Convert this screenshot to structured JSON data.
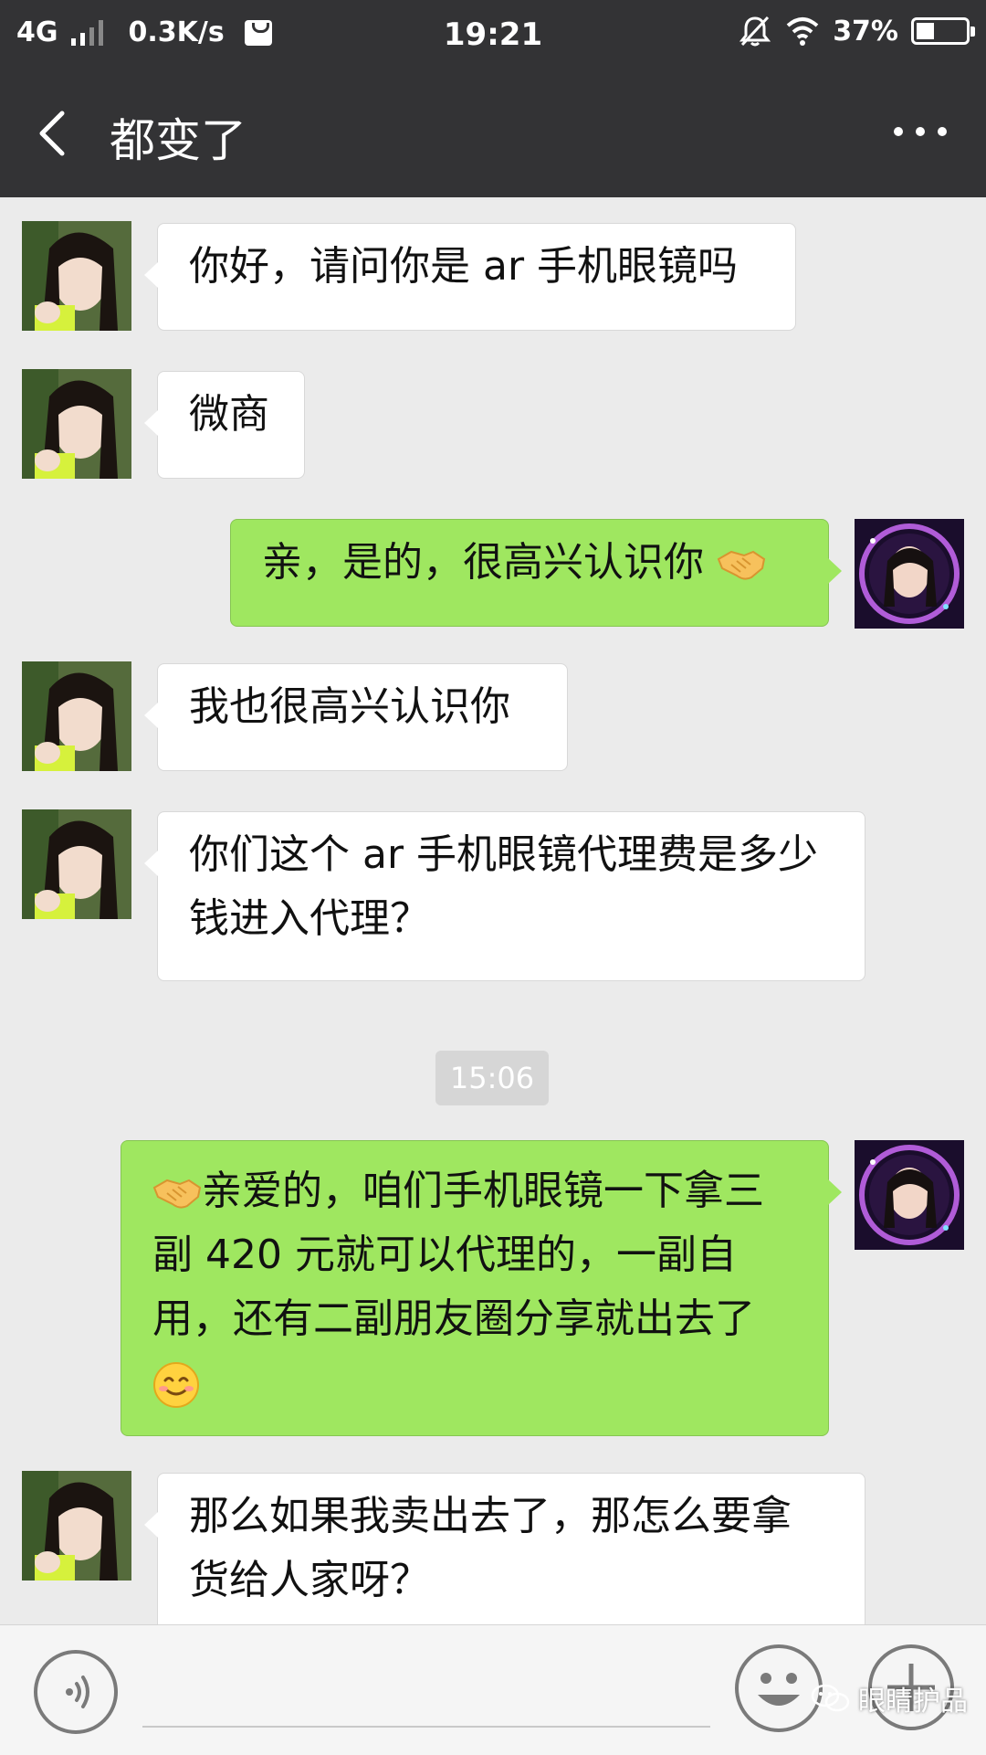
{
  "status_bar": {
    "network": "4G",
    "speed": "0.3K/s",
    "time": "19:21",
    "battery_percent": "37%",
    "battery_level": 0.37,
    "icons": [
      "signal-icon",
      "bag-icon",
      "bell-off-icon",
      "wifi-icon",
      "battery-icon"
    ]
  },
  "header": {
    "title": "都变了",
    "back_icon": "chevron-left-icon",
    "more_icon": "more-dots-icon"
  },
  "messages": [
    {
      "sender": "contact",
      "text": "你好，请问你是 ar 手机眼镜吗"
    },
    {
      "sender": "contact",
      "text": "微商"
    },
    {
      "sender": "me",
      "text": "亲，是的，很高兴认识你",
      "emoji_after": "handshake-icon"
    },
    {
      "sender": "contact",
      "text": "我也很高兴认识你"
    },
    {
      "sender": "contact",
      "lines": [
        "你们这个 ar 手机眼镜代理费是多少",
        "钱进入代理？"
      ]
    },
    {
      "sender": "me",
      "emoji_before": "handshake-icon",
      "lines": [
        "亲爱的，咱们手机眼镜一下拿三",
        "副 420 元就可以代理的，一副自",
        "用，还有二副朋友圈分享就出去了"
      ],
      "emoji_after": "smile-icon"
    },
    {
      "sender": "contact",
      "lines": [
        "那么如果我卖出去了，那怎么要拿",
        "货给人家呀？"
      ]
    }
  ],
  "timestamp": "15:06",
  "input_bar": {
    "voice_icon": "voice-icon",
    "emoji_icon": "emoji-face-icon",
    "plus_icon": "plus-icon"
  },
  "watermark": {
    "text": "眼睛护品"
  },
  "colors": {
    "header_bg": "#333335",
    "chat_bg": "#ebebeb",
    "sent_bubble": "#9fe760",
    "received_bubble": "#ffffff",
    "timestamp_bg": "#d6d6d6"
  }
}
